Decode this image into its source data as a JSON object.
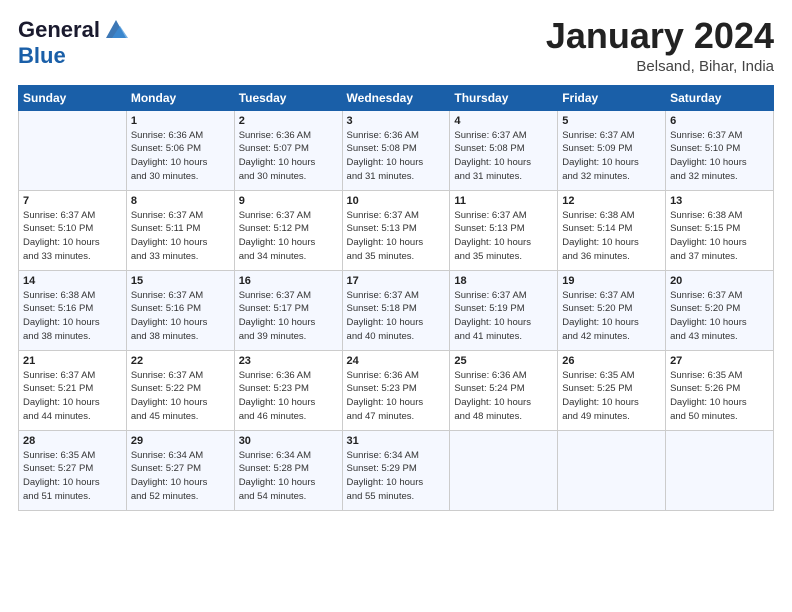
{
  "logo": {
    "line1": "General",
    "line2": "Blue"
  },
  "title": "January 2024",
  "location": "Belsand, Bihar, India",
  "days_header": [
    "Sunday",
    "Monday",
    "Tuesday",
    "Wednesday",
    "Thursday",
    "Friday",
    "Saturday"
  ],
  "weeks": [
    [
      {
        "num": "",
        "info": ""
      },
      {
        "num": "1",
        "info": "Sunrise: 6:36 AM\nSunset: 5:06 PM\nDaylight: 10 hours\nand 30 minutes."
      },
      {
        "num": "2",
        "info": "Sunrise: 6:36 AM\nSunset: 5:07 PM\nDaylight: 10 hours\nand 30 minutes."
      },
      {
        "num": "3",
        "info": "Sunrise: 6:36 AM\nSunset: 5:08 PM\nDaylight: 10 hours\nand 31 minutes."
      },
      {
        "num": "4",
        "info": "Sunrise: 6:37 AM\nSunset: 5:08 PM\nDaylight: 10 hours\nand 31 minutes."
      },
      {
        "num": "5",
        "info": "Sunrise: 6:37 AM\nSunset: 5:09 PM\nDaylight: 10 hours\nand 32 minutes."
      },
      {
        "num": "6",
        "info": "Sunrise: 6:37 AM\nSunset: 5:10 PM\nDaylight: 10 hours\nand 32 minutes."
      }
    ],
    [
      {
        "num": "7",
        "info": "Sunrise: 6:37 AM\nSunset: 5:10 PM\nDaylight: 10 hours\nand 33 minutes."
      },
      {
        "num": "8",
        "info": "Sunrise: 6:37 AM\nSunset: 5:11 PM\nDaylight: 10 hours\nand 33 minutes."
      },
      {
        "num": "9",
        "info": "Sunrise: 6:37 AM\nSunset: 5:12 PM\nDaylight: 10 hours\nand 34 minutes."
      },
      {
        "num": "10",
        "info": "Sunrise: 6:37 AM\nSunset: 5:13 PM\nDaylight: 10 hours\nand 35 minutes."
      },
      {
        "num": "11",
        "info": "Sunrise: 6:37 AM\nSunset: 5:13 PM\nDaylight: 10 hours\nand 35 minutes."
      },
      {
        "num": "12",
        "info": "Sunrise: 6:38 AM\nSunset: 5:14 PM\nDaylight: 10 hours\nand 36 minutes."
      },
      {
        "num": "13",
        "info": "Sunrise: 6:38 AM\nSunset: 5:15 PM\nDaylight: 10 hours\nand 37 minutes."
      }
    ],
    [
      {
        "num": "14",
        "info": "Sunrise: 6:38 AM\nSunset: 5:16 PM\nDaylight: 10 hours\nand 38 minutes."
      },
      {
        "num": "15",
        "info": "Sunrise: 6:37 AM\nSunset: 5:16 PM\nDaylight: 10 hours\nand 38 minutes."
      },
      {
        "num": "16",
        "info": "Sunrise: 6:37 AM\nSunset: 5:17 PM\nDaylight: 10 hours\nand 39 minutes."
      },
      {
        "num": "17",
        "info": "Sunrise: 6:37 AM\nSunset: 5:18 PM\nDaylight: 10 hours\nand 40 minutes."
      },
      {
        "num": "18",
        "info": "Sunrise: 6:37 AM\nSunset: 5:19 PM\nDaylight: 10 hours\nand 41 minutes."
      },
      {
        "num": "19",
        "info": "Sunrise: 6:37 AM\nSunset: 5:20 PM\nDaylight: 10 hours\nand 42 minutes."
      },
      {
        "num": "20",
        "info": "Sunrise: 6:37 AM\nSunset: 5:20 PM\nDaylight: 10 hours\nand 43 minutes."
      }
    ],
    [
      {
        "num": "21",
        "info": "Sunrise: 6:37 AM\nSunset: 5:21 PM\nDaylight: 10 hours\nand 44 minutes."
      },
      {
        "num": "22",
        "info": "Sunrise: 6:37 AM\nSunset: 5:22 PM\nDaylight: 10 hours\nand 45 minutes."
      },
      {
        "num": "23",
        "info": "Sunrise: 6:36 AM\nSunset: 5:23 PM\nDaylight: 10 hours\nand 46 minutes."
      },
      {
        "num": "24",
        "info": "Sunrise: 6:36 AM\nSunset: 5:23 PM\nDaylight: 10 hours\nand 47 minutes."
      },
      {
        "num": "25",
        "info": "Sunrise: 6:36 AM\nSunset: 5:24 PM\nDaylight: 10 hours\nand 48 minutes."
      },
      {
        "num": "26",
        "info": "Sunrise: 6:35 AM\nSunset: 5:25 PM\nDaylight: 10 hours\nand 49 minutes."
      },
      {
        "num": "27",
        "info": "Sunrise: 6:35 AM\nSunset: 5:26 PM\nDaylight: 10 hours\nand 50 minutes."
      }
    ],
    [
      {
        "num": "28",
        "info": "Sunrise: 6:35 AM\nSunset: 5:27 PM\nDaylight: 10 hours\nand 51 minutes."
      },
      {
        "num": "29",
        "info": "Sunrise: 6:34 AM\nSunset: 5:27 PM\nDaylight: 10 hours\nand 52 minutes."
      },
      {
        "num": "30",
        "info": "Sunrise: 6:34 AM\nSunset: 5:28 PM\nDaylight: 10 hours\nand 54 minutes."
      },
      {
        "num": "31",
        "info": "Sunrise: 6:34 AM\nSunset: 5:29 PM\nDaylight: 10 hours\nand 55 minutes."
      },
      {
        "num": "",
        "info": ""
      },
      {
        "num": "",
        "info": ""
      },
      {
        "num": "",
        "info": ""
      }
    ]
  ]
}
